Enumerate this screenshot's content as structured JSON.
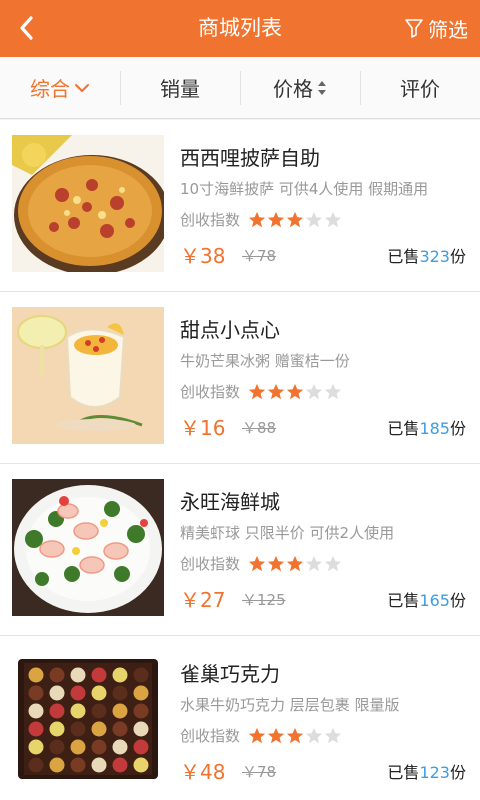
{
  "header": {
    "title": "商城列表",
    "filter_label": "筛选",
    "back_icon": "chevron-left-icon",
    "filter_icon": "funnel-icon",
    "bg_color": "#f0732f"
  },
  "sort_tabs": [
    {
      "label": "综合",
      "active": true,
      "icon": "chevron-down-icon"
    },
    {
      "label": "销量",
      "active": false
    },
    {
      "label": "价格",
      "active": false,
      "icon": "sort-arrows-icon"
    },
    {
      "label": "评价",
      "active": false
    }
  ],
  "items": [
    {
      "name": "西西哩披萨自助",
      "desc": "10寸海鲜披萨 可供4人使用 假期通用",
      "rating_label": "创收指数",
      "rating": 3,
      "rating_max": 5,
      "price": "￥38",
      "orig_price": "￥78",
      "sold_prefix": "已售",
      "sold_count": "323",
      "sold_suffix": "份",
      "image": "pizza"
    },
    {
      "name": "甜点小点心",
      "desc": "牛奶芒果冰粥  赠蜜桔一份",
      "rating_label": "创收指数",
      "rating": 3,
      "rating_max": 5,
      "price": "￥16",
      "orig_price": "￥88",
      "sold_prefix": "已售",
      "sold_count": "185",
      "sold_suffix": "份",
      "image": "dessert"
    },
    {
      "name": "永旺海鲜城",
      "desc": "精美虾球 只限半价 可供2人使用",
      "rating_label": "创收指数",
      "rating": 3,
      "rating_max": 5,
      "price": "￥27",
      "orig_price": "￥125",
      "sold_prefix": "已售",
      "sold_count": "165",
      "sold_suffix": "份",
      "image": "seafood"
    },
    {
      "name": "雀巢巧克力",
      "desc": "水果牛奶巧克力 层层包裹 限量版",
      "rating_label": "创收指数",
      "rating": 3,
      "rating_max": 5,
      "price": "￥48",
      "orig_price": "￥78",
      "sold_prefix": "已售",
      "sold_count": "123",
      "sold_suffix": "份",
      "image": "chocolate"
    }
  ],
  "colors": {
    "accent": "#f0732f",
    "sold_number": "#3c9de0",
    "star_on": "#f0732f",
    "star_off": "#dddddd"
  }
}
